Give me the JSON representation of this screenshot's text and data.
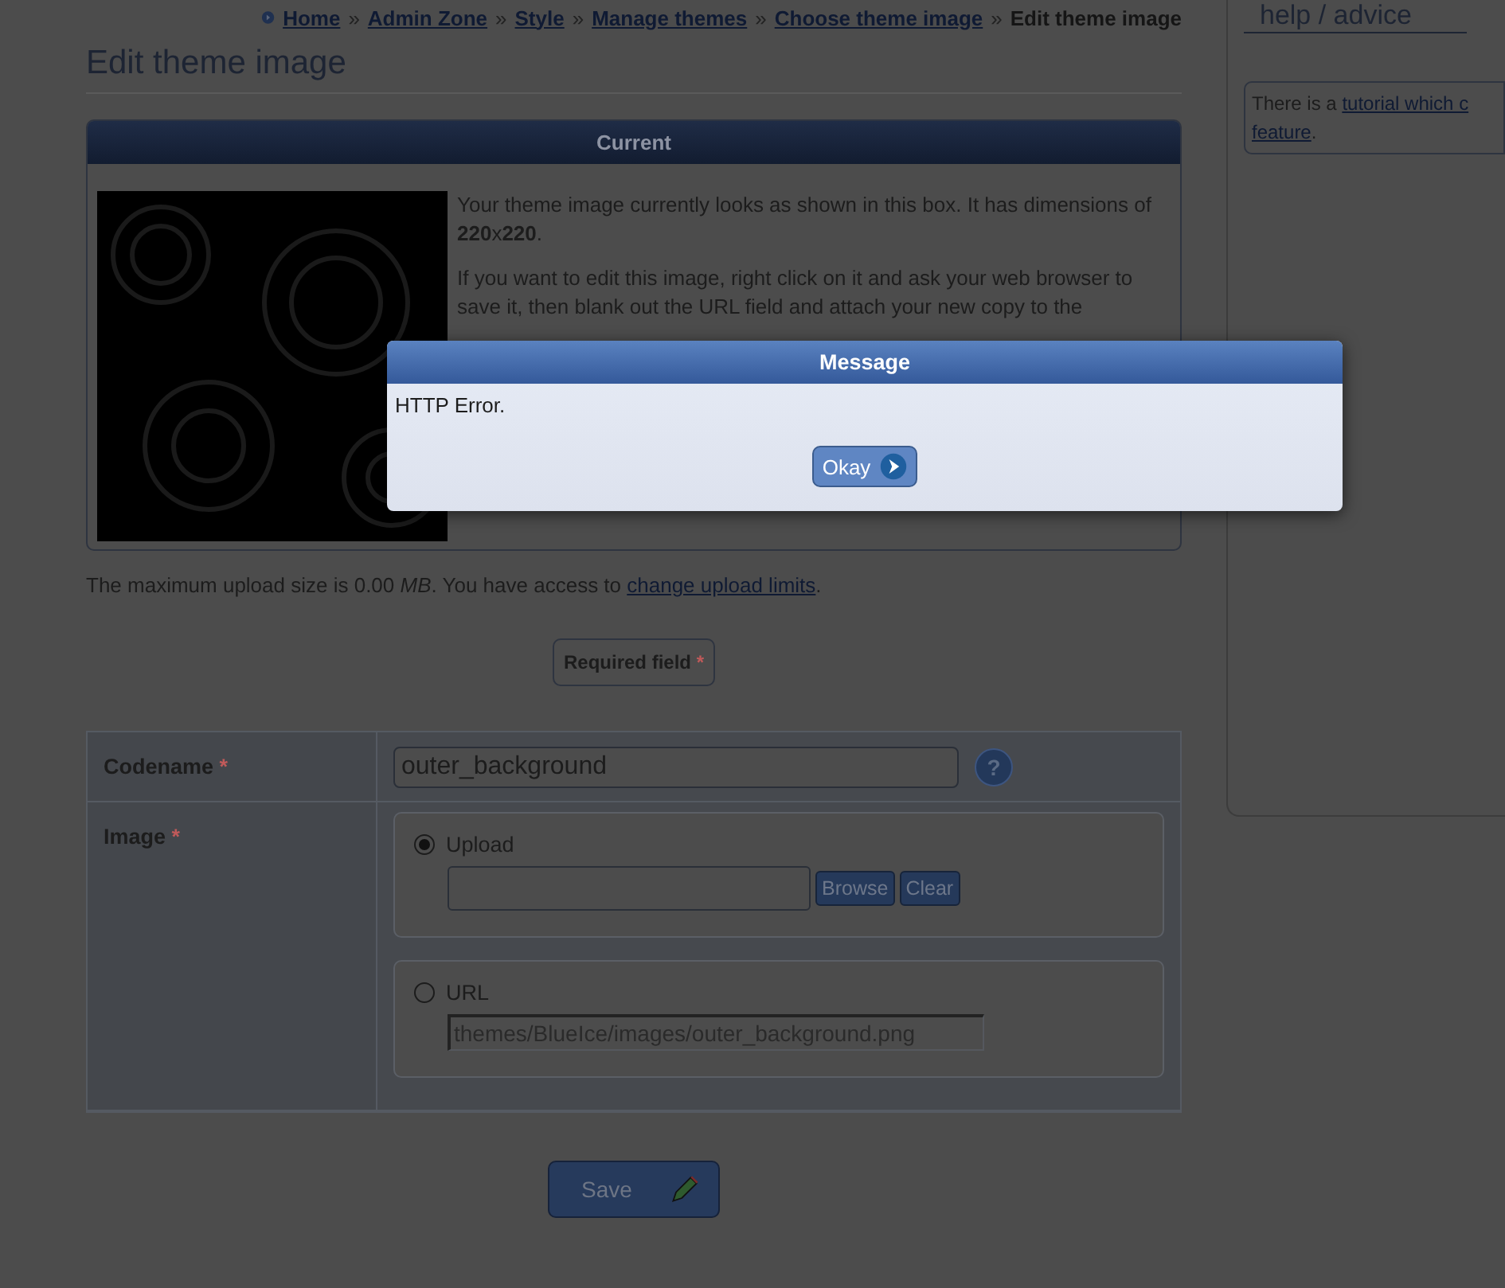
{
  "breadcrumb": [
    {
      "label": "Home",
      "link": true
    },
    {
      "label": "Admin Zone",
      "link": true
    },
    {
      "label": "Style",
      "link": true
    },
    {
      "label": "Manage themes",
      "link": true
    },
    {
      "label": "Choose theme image",
      "link": true
    },
    {
      "label": "Edit theme image",
      "link": false
    }
  ],
  "breadcrumb_separator": "»",
  "title": "Edit theme image",
  "current_panel": {
    "header": "Current",
    "paragraphs": [
      "Your theme image currently looks as shown in this box. It has dimensions of **220**x**220**.",
      "If you want to edit this image, right click on it and ask your web browser to save it, then blank out the URL field and attach your new copy to the"
    ]
  },
  "upload_note": {
    "text": "The maximum upload size is 0.00 *MB*. You have access to ",
    "link": "change upload limits",
    "end": "."
  },
  "required_legend": {
    "label": "Required field",
    "marker": "*"
  },
  "form": {
    "codename": {
      "label": "Codename",
      "marker": "*",
      "value": "outer_background",
      "help": "?"
    },
    "image": {
      "label": "Image",
      "marker": "*",
      "options": [
        {
          "label": "Upload",
          "selected": true,
          "kind": "file",
          "buttons": [
            "Browse",
            "Clear"
          ]
        },
        {
          "label": "URL",
          "selected": false,
          "kind": "text",
          "value": "themes/BlueIce/images/outer_background.png"
        }
      ]
    }
  },
  "save_button": "Save",
  "sidebar": {
    "title": "help / advice",
    "text_start": "There is a ",
    "links": [
      "tutorial which c",
      "feature"
    ],
    "text_end": "."
  },
  "dialog": {
    "title": "Message",
    "message": "HTTP Error.",
    "button": "Okay"
  }
}
